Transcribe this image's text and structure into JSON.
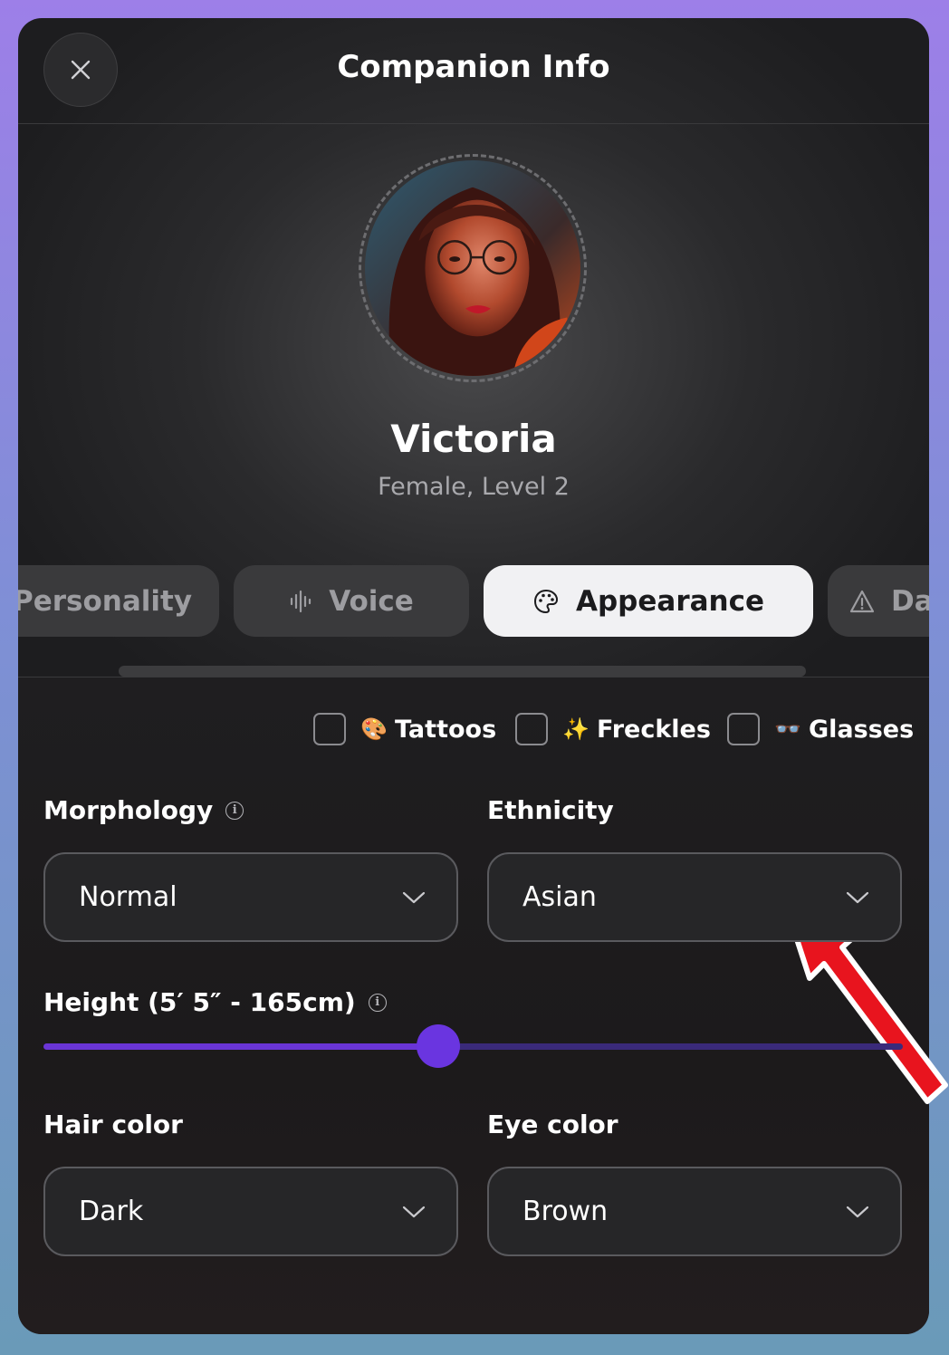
{
  "header": {
    "title": "Companion Info"
  },
  "profile": {
    "name": "Victoria",
    "subtitle": "Female, Level 2"
  },
  "tabs": [
    {
      "label": "Personality",
      "icon": "personality-icon",
      "active": false
    },
    {
      "label": "Voice",
      "icon": "waveform-icon",
      "active": false
    },
    {
      "label": "Appearance",
      "icon": "palette-icon",
      "active": true
    },
    {
      "label": "Dar",
      "icon": "warning-icon",
      "active": false
    }
  ],
  "toggles": [
    {
      "label": "Tattoos",
      "emoji": "🎨",
      "checked": false
    },
    {
      "label": "Freckles",
      "emoji": "✨",
      "checked": false
    },
    {
      "label": "Glasses",
      "emoji": "👓",
      "checked": false
    }
  ],
  "fields": {
    "morphology": {
      "label": "Morphology",
      "value": "Normal"
    },
    "ethnicity": {
      "label": "Ethnicity",
      "value": "Asian"
    },
    "height": {
      "label": "Height (5′ 5″ - 165cm)",
      "fraction": 0.46
    },
    "hair_color": {
      "label": "Hair color",
      "value": "Dark"
    },
    "eye_color": {
      "label": "Eye color",
      "value": "Brown"
    }
  },
  "colors": {
    "accent": "#6a35e0",
    "annotation_arrow": "#e8141e"
  }
}
